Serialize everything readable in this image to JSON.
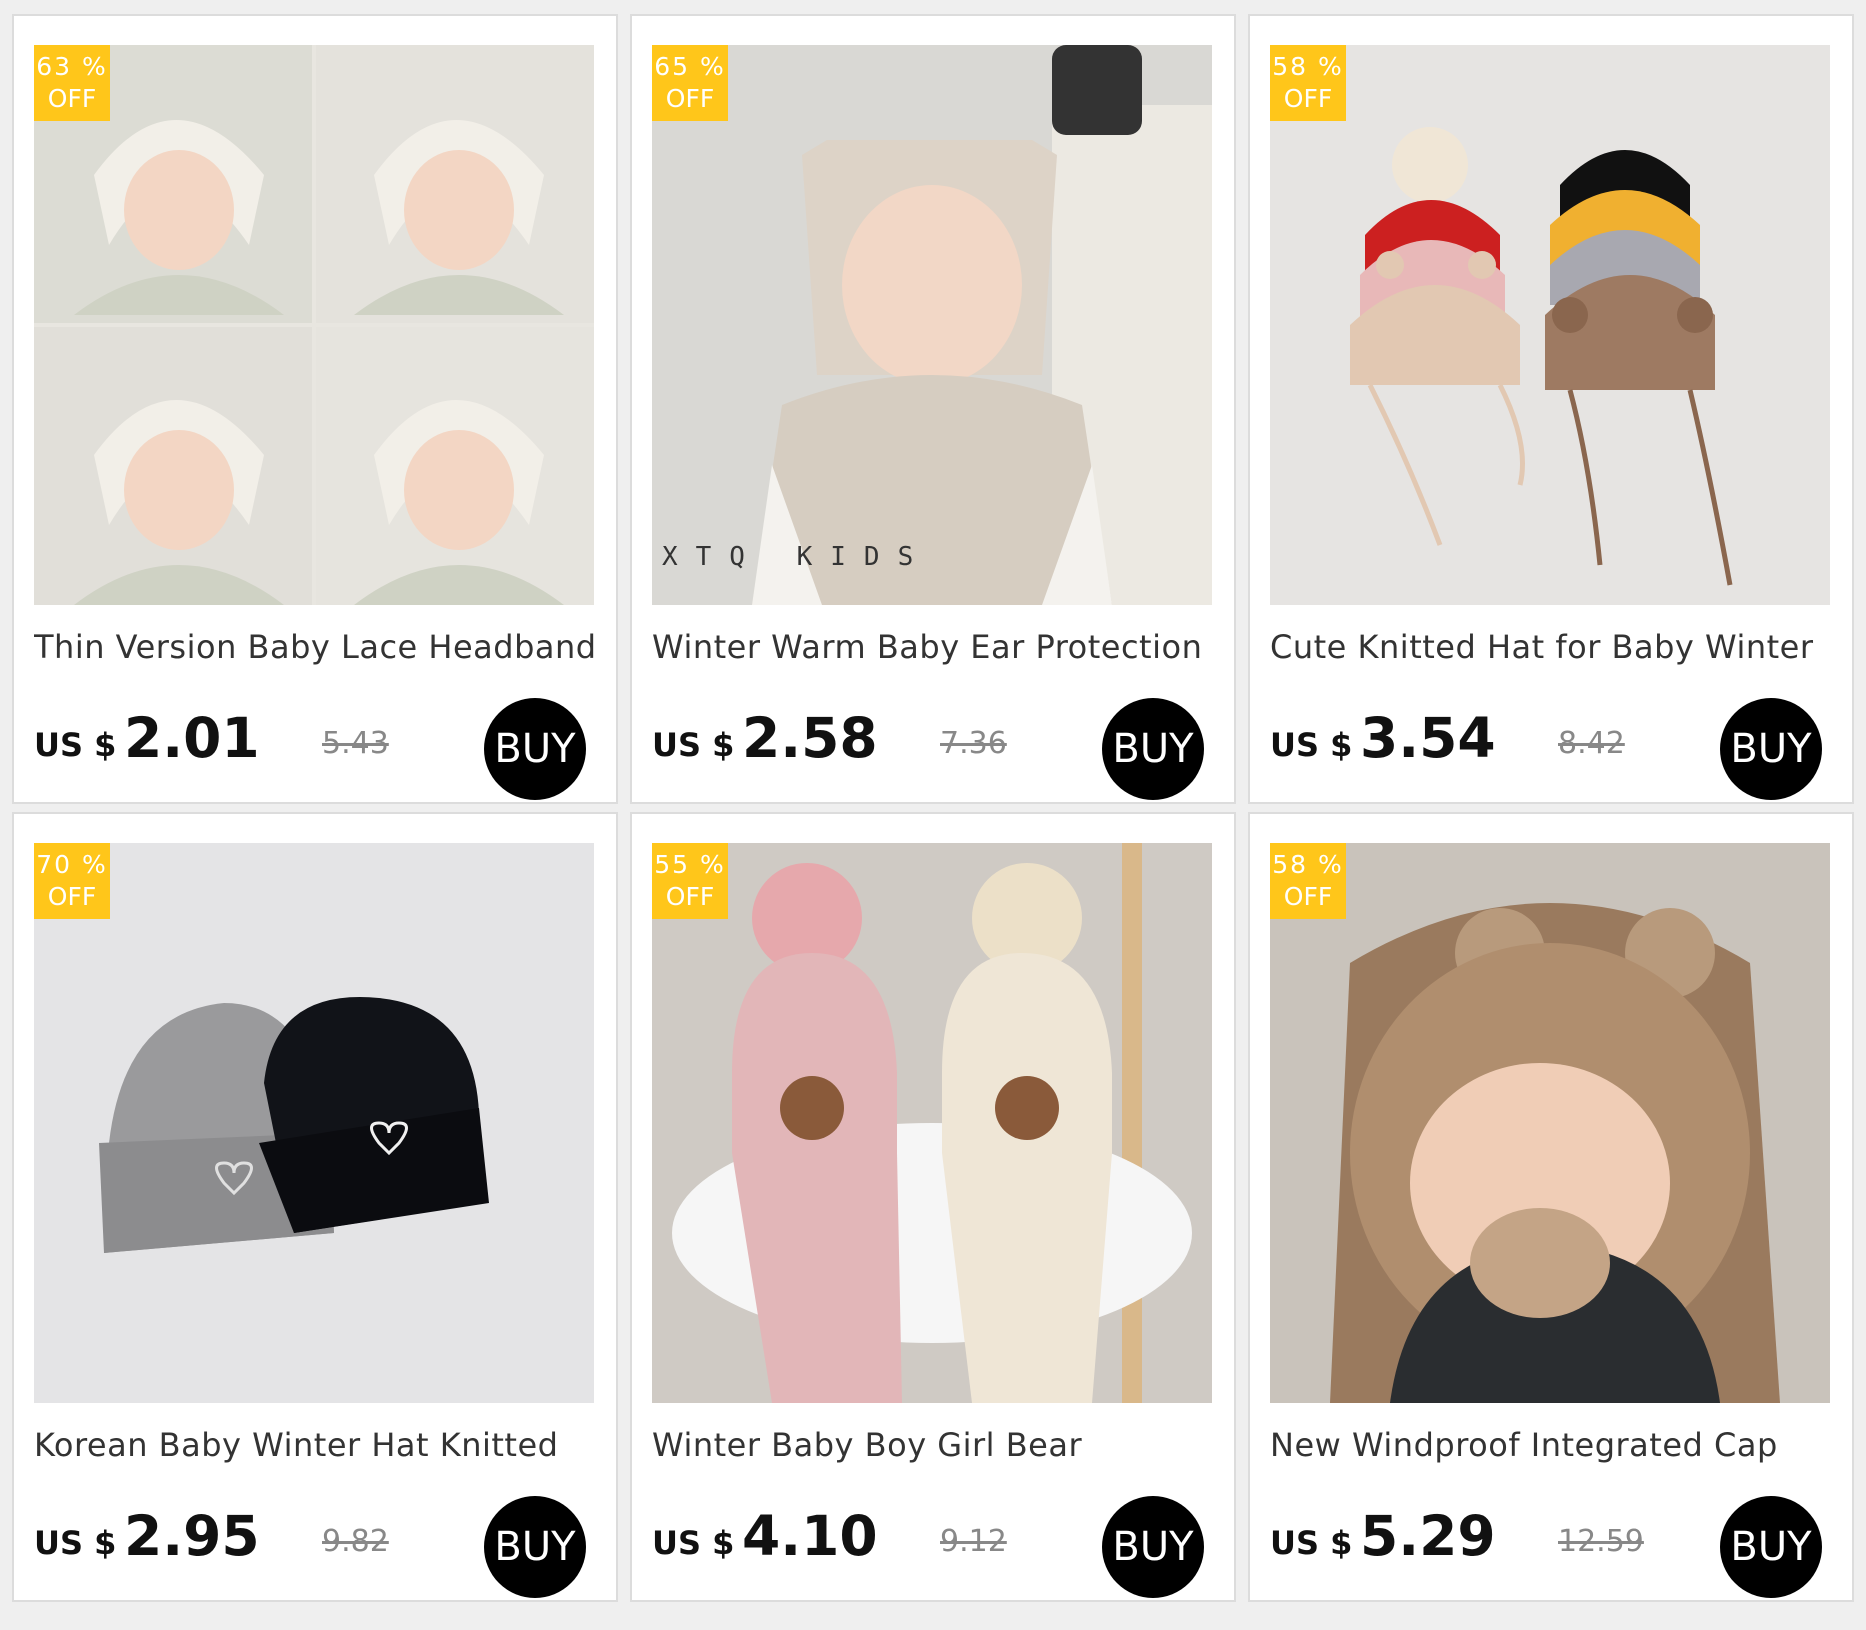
{
  "currency_label": "US $",
  "buy_label": "BUY",
  "badge_off": "OFF",
  "badge_color": "#ffc61a",
  "products": [
    {
      "title": "Thin Version Baby Lace Headband",
      "discount": "63 %",
      "price": "2.01",
      "old_price": "5.43"
    },
    {
      "title": "Winter Warm Baby Ear Protection",
      "discount": "65 %",
      "price": "2.58",
      "old_price": "7.36",
      "watermark": "XTQ KIDS"
    },
    {
      "title": "Cute Knitted Hat for Baby Winter",
      "discount": "58 %",
      "price": "3.54",
      "old_price": "8.42"
    },
    {
      "title": "Korean Baby Winter Hat Knitted",
      "discount": "70 %",
      "price": "2.95",
      "old_price": "9.82"
    },
    {
      "title": "Winter Baby Boy Girl Bear",
      "discount": "55 %",
      "price": "4.10",
      "old_price": "9.12"
    },
    {
      "title": "New Windproof Integrated Cap",
      "discount": "58 %",
      "price": "5.29",
      "old_price": "12.59"
    }
  ]
}
